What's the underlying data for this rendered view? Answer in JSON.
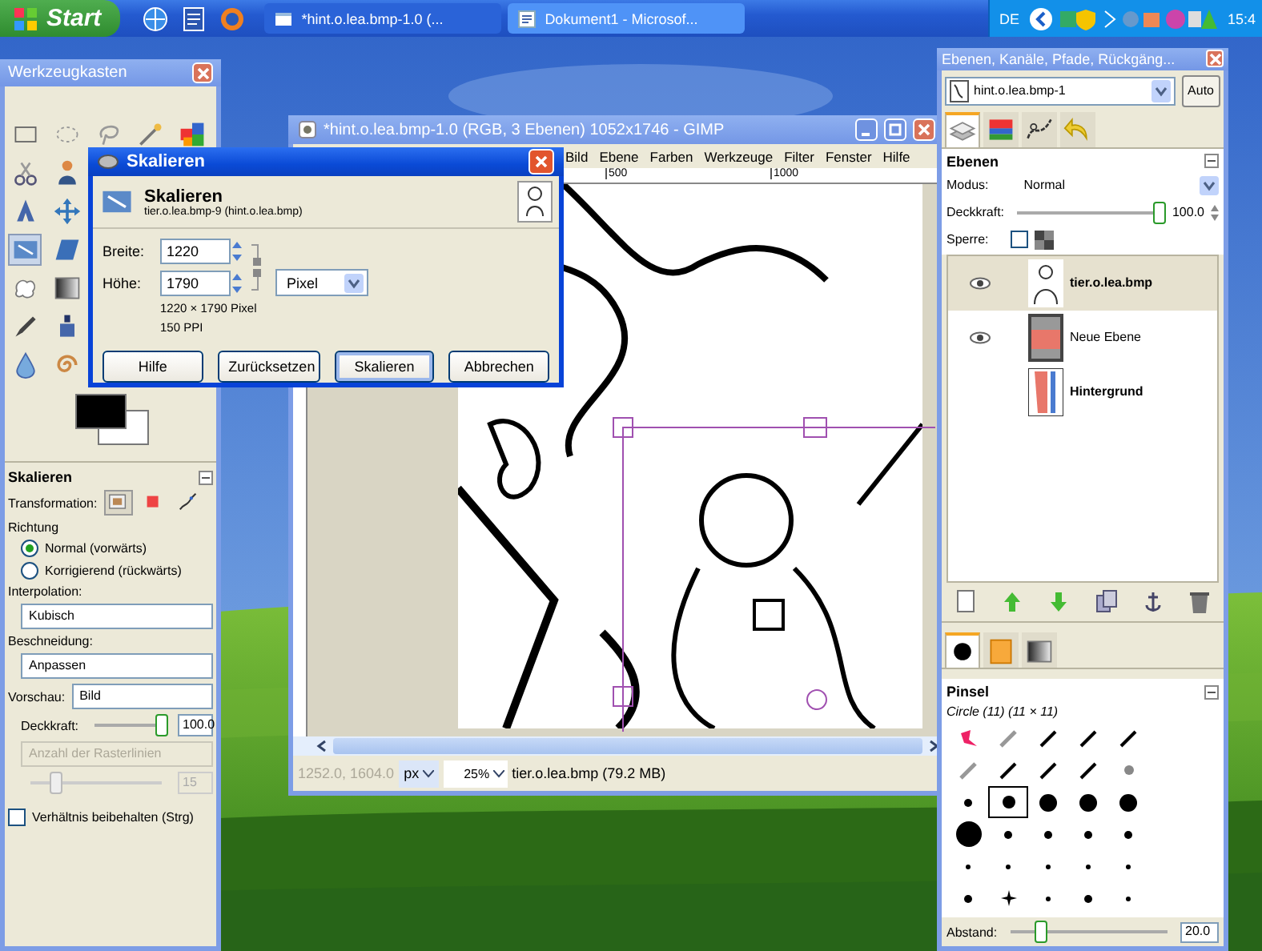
{
  "taskbar": {
    "start": "Start",
    "tasks": [
      {
        "label": "*hint.o.lea.bmp-1.0 (...",
        "selected": false
      },
      {
        "label": "Dokument1 - Microsof...",
        "selected": true
      }
    ],
    "language": "DE",
    "clock": "15:4"
  },
  "toolbox": {
    "title": "Werkzeugkasten",
    "tool_rows": [
      {
        "tools": [
          {
            "kind": "rect",
            "selected": false
          },
          {
            "kind": "ellipse",
            "selected": false
          },
          {
            "kind": "lasso",
            "selected": false
          },
          {
            "kind": "wand",
            "selected": false
          },
          {
            "kind": "colors",
            "selected": false
          }
        ]
      },
      {
        "tools": [
          {
            "kind": "scissors",
            "selected": false
          },
          {
            "kind": "figure",
            "selected": false
          }
        ]
      },
      {
        "tools": [
          {
            "kind": "align",
            "selected": false
          },
          {
            "kind": "move",
            "selected": false
          }
        ]
      },
      {
        "tools": [
          {
            "kind": "scale",
            "selected": true
          },
          {
            "kind": "shear",
            "selected": false
          }
        ]
      },
      {
        "tools": [
          {
            "kind": "blob",
            "selected": false
          },
          {
            "kind": "gradient",
            "selected": false
          }
        ]
      },
      {
        "tools": [
          {
            "kind": "pen",
            "selected": false
          },
          {
            "kind": "bottle",
            "selected": false
          }
        ]
      },
      {
        "tools": [
          {
            "kind": "drop",
            "selected": false
          },
          {
            "kind": "snail",
            "selected": false
          }
        ]
      }
    ],
    "options": {
      "title": "Skalieren",
      "transformation_label": "Transformation:",
      "transform_modes": [
        {
          "kind": "layer",
          "selected": true
        },
        {
          "kind": "selection",
          "selected": false
        },
        {
          "kind": "path",
          "selected": false
        }
      ],
      "direction_label": "Richtung",
      "directions": [
        {
          "label": "Normal (vorwärts)",
          "selected": true
        },
        {
          "label": "Korrigierend (rückwärts)",
          "selected": false
        }
      ],
      "interpolation_label": "Interpolation:",
      "interpolation": "Kubisch",
      "clipping_label": "Beschneidung:",
      "clipping": "Anpassen",
      "preview_label": "Vorschau:",
      "preview": "Bild",
      "opacity_label": "Deckkraft:",
      "opacity": {
        "level": 1,
        "reading": "100.0"
      },
      "grid_lines": {
        "placeholder": "Anzahl der Rasterlinien",
        "disabled": true
      },
      "grid_count": {
        "level": 0.2,
        "reading": "15",
        "disabled": true
      },
      "keep_ratio": {
        "label": "Verhältnis beibehalten (Strg)",
        "checked": false
      }
    }
  },
  "image_window": {
    "title": "*hint.o.lea.bmp-1.0 (RGB, 3 Ebenen) 1052x1746 - GIMP",
    "menu": [
      "Bild",
      "Ebene",
      "Farben",
      "Werkzeuge",
      "Filter",
      "Fenster",
      "Hilfe"
    ],
    "ruler_ticks": [
      "500",
      "1000"
    ],
    "status": {
      "coords": "1252.0, 1604.0",
      "unit": "px",
      "zoom": "25%",
      "info": "tier.o.lea.bmp (79.2 MB)"
    }
  },
  "scale_dialog": {
    "title": "Skalieren",
    "heading": "Skalieren",
    "subtitle": "tier.o.lea.bmp-9 (hint.o.lea.bmp)",
    "width": {
      "label": "Breite:",
      "value": "1220"
    },
    "height": {
      "label": "Höhe:",
      "value": "1790"
    },
    "unit": "Pixel",
    "size_info": "1220 × 1790 Pixel",
    "resolution": "150 PPI",
    "buttons": [
      {
        "label": "Hilfe",
        "focused": false
      },
      {
        "label": "Zurücksetzen",
        "focused": false
      },
      {
        "label": "Skalieren",
        "focused": true
      },
      {
        "label": "Abbrechen",
        "focused": false
      }
    ]
  },
  "dock": {
    "title": "Ebenen, Kanäle, Pfade, Rückgäng...",
    "image": "hint.o.lea.bmp-1",
    "auto": "Auto",
    "tabs": [
      {
        "kind": "layers",
        "selected": true
      },
      {
        "kind": "channels",
        "selected": false
      },
      {
        "kind": "paths",
        "selected": false
      },
      {
        "kind": "undo",
        "selected": false
      }
    ],
    "layers_title": "Ebenen",
    "mode_label": "Modus:",
    "mode": "Normal",
    "opacity_label": "Deckkraft:",
    "opacity": {
      "level": 1,
      "reading": "100.0"
    },
    "lock_label": "Sperre:",
    "lock_pixels": {
      "checked": false
    },
    "layers": [
      {
        "name": "tier.o.lea.bmp",
        "visible": true,
        "selected": true,
        "bold": true,
        "kind": "drawing"
      },
      {
        "name": "Neue Ebene",
        "visible": true,
        "selected": false,
        "bold": false,
        "kind": "checker"
      },
      {
        "name": "Hintergrund",
        "visible": false,
        "selected": false,
        "bold": true,
        "kind": "red"
      }
    ],
    "brush_tabs": [
      {
        "kind": "brush",
        "selected": true
      },
      {
        "kind": "pattern",
        "selected": false
      },
      {
        "kind": "gradient",
        "selected": false
      }
    ],
    "brushes_title": "Pinsel",
    "brush_name": "Circle (11) (11 × 11)",
    "brushes": [
      {
        "kind": "splat",
        "selected": false
      },
      {
        "kind": "fuzzy-line",
        "selected": false
      },
      {
        "kind": "line",
        "selected": false
      },
      {
        "kind": "line",
        "selected": false
      },
      {
        "kind": "line",
        "selected": false
      },
      {
        "kind": "fuzzy-line",
        "selected": false
      },
      {
        "kind": "line",
        "selected": false
      },
      {
        "kind": "line",
        "selected": false
      },
      {
        "kind": "line",
        "selected": false
      },
      {
        "kind": "fuzzy",
        "selected": false
      },
      {
        "kind": "dot-s",
        "selected": false
      },
      {
        "kind": "dot-m",
        "selected": true
      },
      {
        "kind": "dot-l",
        "selected": false
      },
      {
        "kind": "dot-l",
        "selected": false
      },
      {
        "kind": "dot-l",
        "selected": false
      },
      {
        "kind": "dot-xl",
        "selected": false
      },
      {
        "kind": "dot-s",
        "selected": false
      },
      {
        "kind": "dot-s",
        "selected": false
      },
      {
        "kind": "dot-s",
        "selected": false
      },
      {
        "kind": "dot-s",
        "selected": false
      },
      {
        "kind": "dot-xs",
        "selected": false
      },
      {
        "kind": "dot-xs",
        "selected": false
      },
      {
        "kind": "dot-xs",
        "selected": false
      },
      {
        "kind": "dot-xs",
        "selected": false
      },
      {
        "kind": "dot-xs",
        "selected": false
      },
      {
        "kind": "dot-s",
        "selected": false
      },
      {
        "kind": "star",
        "selected": false
      },
      {
        "kind": "dot-xs",
        "selected": false
      },
      {
        "kind": "dot-s",
        "selected": false
      },
      {
        "kind": "dot-xs",
        "selected": false
      }
    ],
    "spacing_label": "Abstand:",
    "spacing": {
      "level": 0.2,
      "reading": "20.0"
    }
  }
}
